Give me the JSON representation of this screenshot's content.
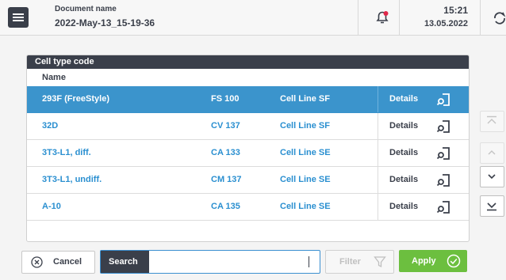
{
  "header": {
    "doc_label": "Document name",
    "doc_name": "2022-May-13_15-19-36",
    "time": "15:21",
    "date": "13.05.2022"
  },
  "panel": {
    "title": "Cell type code",
    "column_header": "Name",
    "rows": [
      {
        "name": "293F (FreeStyle)",
        "code": "FS 100",
        "type": "Cell Line SF",
        "details": "Details",
        "selected": true
      },
      {
        "name": "32D",
        "code": "CV 137",
        "type": "Cell Line SF",
        "details": "Details",
        "selected": false
      },
      {
        "name": "3T3-L1, diff.",
        "code": "CA 133",
        "type": "Cell Line SE",
        "details": "Details",
        "selected": false
      },
      {
        "name": "3T3-L1, undiff.",
        "code": "CM 137",
        "type": "Cell Line SE",
        "details": "Details",
        "selected": false
      },
      {
        "name": "A-10",
        "code": "CA 135",
        "type": "Cell Line SE",
        "details": "Details",
        "selected": false
      }
    ]
  },
  "bottom": {
    "cancel_label": "Cancel",
    "search_label": "Search",
    "search_value": "",
    "filter_label": "Filter",
    "apply_label": "Apply"
  },
  "icons": {
    "menu": "hamburger-menu-icon",
    "bell": "notification-bell-icon",
    "sync": "sync-icon",
    "details": "search-detail-icon",
    "cancel": "close-circle-icon",
    "filter": "funnel-icon",
    "apply": "check-circle-icon"
  },
  "colors": {
    "header_dark": "#3a3f4a",
    "selected_row": "#3b94cc",
    "link_blue": "#2a8fd0",
    "apply_green": "#6cbf3f",
    "notification_red": "#e0294a"
  }
}
